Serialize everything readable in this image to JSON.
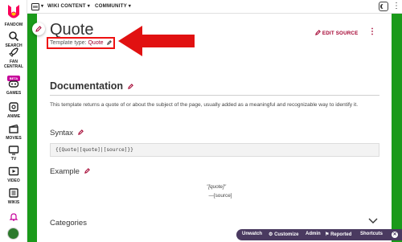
{
  "rail": {
    "logo_text": "FANDOM",
    "items": [
      {
        "label": "SEARCH",
        "icon": "search-icon"
      },
      {
        "label": "FAN CENTRAL",
        "icon": "rocket-icon",
        "badge": "BETA"
      },
      {
        "label": "GAMES",
        "icon": "controller-icon"
      },
      {
        "label": "ANIME",
        "icon": "anime-icon"
      },
      {
        "label": "MOVIES",
        "icon": "clapperboard-icon"
      },
      {
        "label": "TV",
        "icon": "tv-icon"
      },
      {
        "label": "VIDEO",
        "icon": "video-icon"
      },
      {
        "label": "WIKIS",
        "icon": "wikis-icon"
      }
    ],
    "bell_icon": "bell-icon",
    "avatar": "user-avatar"
  },
  "topbar": {
    "wiki_content": "WIKI CONTENT",
    "community": "COMMUNITY"
  },
  "page": {
    "title": "Quote",
    "template_type_label": "Template type:",
    "template_type_value": "Quote",
    "edit_source": "EDIT SOURCE",
    "doc_heading": "Documentation",
    "doc_text": "This template returns a quote of or about the subject of the page, usually added as a meaningful and recognizable way to identify it.",
    "syntax_heading": "Syntax",
    "syntax_code": "{{Quote|[quote]|[source]}}",
    "example_heading": "Example",
    "example_quote": "\"[quote]\"",
    "example_source": "—[source]",
    "categories_heading": "Categories"
  },
  "toolbar": {
    "unwatch": "Unwatch",
    "customize": "Customize",
    "admin": "Admin",
    "reported": "Reported",
    "shortcuts": "Shortcuts"
  },
  "colors": {
    "accent": "#a3002f",
    "highlight": "#e11111",
    "background_green": "#1a9a1a",
    "toolbar_bg": "#4a3a60",
    "badge": "#c6019a"
  }
}
